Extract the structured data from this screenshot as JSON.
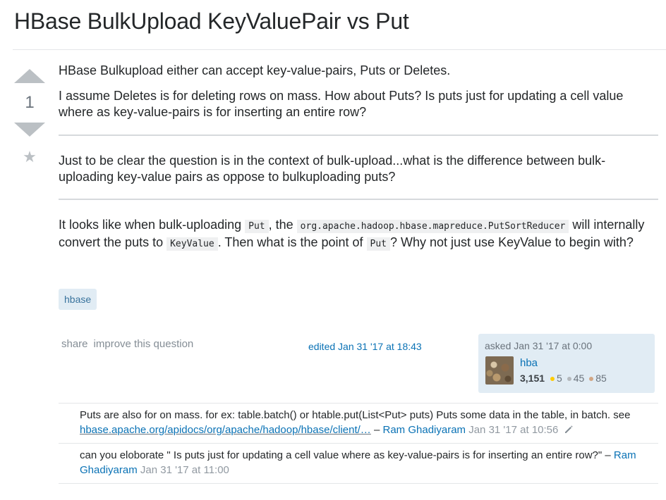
{
  "question": {
    "title": "HBase BulkUpload KeyValuePair vs Put",
    "votes": "1",
    "body": {
      "p1": "HBase Bulkupload either can accept key-value-pairs, Puts or Deletes.",
      "p2": "I assume Deletes is for deleting rows on mass. How about Puts? Is puts just for updating a cell value where as key-value-pairs is for inserting an entire row?",
      "p3": "Just to be clear the question is in the context of bulk-upload...what is the difference between bulk-uploading key-value pairs as oppose to bulkuploading puts?",
      "p4": {
        "t1": "It looks like when bulk-uploading ",
        "code1": "Put",
        "t2": ", the ",
        "code2": "org.apache.hadoop.hbase.mapreduce.PutSortReducer",
        "t3": " will internally convert the puts to ",
        "code3": "KeyValue",
        "t4": ". Then what is the point of ",
        "code4": "Put",
        "t5": "? Why not just use KeyValue to begin with?"
      }
    },
    "tags": [
      "hbase"
    ],
    "menu": {
      "share": "share",
      "improve": "improve this question"
    },
    "edited": "edited Jan 31 '17 at 18:43",
    "owner": {
      "asked": "asked Jan 31 '17 at 0:00",
      "name": "hba",
      "reputation": "3,151",
      "gold": "5",
      "silver": "45",
      "bronze": "85"
    }
  },
  "comments": [
    {
      "text": "Puts are also for on mass. for ex: table.batch() or htable.put(List<Put> puts) Puts some data in the table, in batch. see ",
      "link": "hbase.apache.org/apidocs/org/apache/hadoop/hbase/client/…",
      "dash": " – ",
      "user": "Ram Ghadiyaram",
      "date": "Jan 31 '17 at 10:56"
    },
    {
      "text": "can you eloborate \" Is puts just for updating a cell value where as key-value-pairs is for inserting an entire row?\" ",
      "dash": "– ",
      "user": "Ram Ghadiyaram",
      "date": "Jan 31 '17 at 11:00"
    }
  ],
  "colors": {
    "link": "#0a72b5",
    "tag_bg": "#e1ecf4",
    "tag_text": "#39739d",
    "vote_arrow": "#bbc0c4",
    "muted": "#848d95"
  },
  "icons": [
    "upvote-arrow-icon",
    "downvote-arrow-icon",
    "favorite-star-icon",
    "pencil-edit-icon",
    "gold-badge-icon",
    "silver-badge-icon",
    "bronze-badge-icon"
  ]
}
